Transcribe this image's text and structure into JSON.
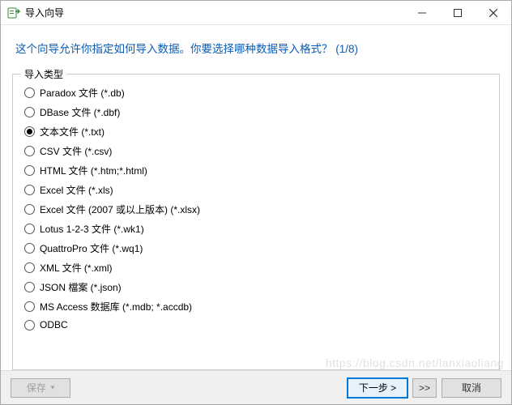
{
  "titlebar": {
    "title": "导入向导",
    "icon_name": "import-wizard-icon"
  },
  "headline": "这个向导允许你指定如何导入数据。你要选择哪种数据导入格式？ (1/8)",
  "group": {
    "legend": "导入类型",
    "selected_index": 2,
    "options": [
      {
        "label": "Paradox 文件 (*.db)"
      },
      {
        "label": "DBase 文件 (*.dbf)"
      },
      {
        "label": "文本文件 (*.txt)"
      },
      {
        "label": "CSV 文件 (*.csv)"
      },
      {
        "label": "HTML 文件 (*.htm;*.html)"
      },
      {
        "label": "Excel 文件 (*.xls)"
      },
      {
        "label": "Excel 文件 (2007 或以上版本) (*.xlsx)"
      },
      {
        "label": "Lotus 1-2-3 文件 (*.wk1)"
      },
      {
        "label": "QuattroPro 文件 (*.wq1)"
      },
      {
        "label": "XML 文件 (*.xml)"
      },
      {
        "label": "JSON 檔案 (*.json)"
      },
      {
        "label": "MS Access 数据库 (*.mdb; *.accdb)"
      },
      {
        "label": "ODBC"
      }
    ]
  },
  "footer": {
    "save_label": "保存",
    "save_suffix": "▾",
    "next_label": "下一步 >",
    "skip_label": ">>",
    "cancel_label": "取消"
  },
  "watermark": "https://blog.csdn.net/lanxiaoliang"
}
